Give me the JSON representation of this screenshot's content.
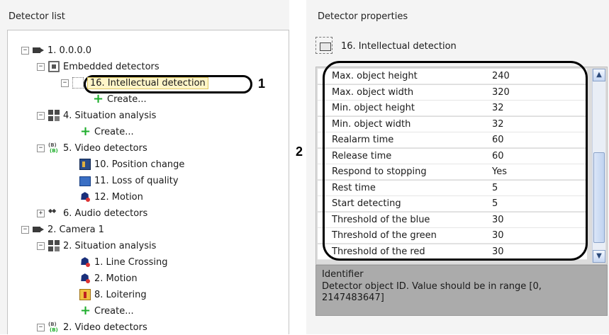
{
  "left_panel": {
    "title": "Detector list",
    "tree": [
      {
        "label": "1. 0.0.0.0",
        "icon": "camera-icon",
        "expander": "−"
      },
      {
        "label": "Embedded detectors",
        "icon": "embedded-detector-icon",
        "expander": "−"
      },
      {
        "label": "16. Intellectual detection",
        "icon": "intellectual-detection-icon",
        "expander": "−",
        "selected": true
      },
      {
        "label": "Create...",
        "icon": "green-plus-icon"
      },
      {
        "label": "4. Situation analysis",
        "icon": "situation-analysis-icon",
        "expander": "−"
      },
      {
        "label": "Create...",
        "icon": "green-plus-icon"
      },
      {
        "label": "5. Video detectors",
        "icon": "video-detectors-icon",
        "expander": "−"
      },
      {
        "label": "10. Position change",
        "icon": "position-change-icon"
      },
      {
        "label": "11. Loss of quality",
        "icon": "loss-of-quality-icon"
      },
      {
        "label": "12. Motion",
        "icon": "motion-icon"
      },
      {
        "label": "6. Audio detectors",
        "icon": "audio-detectors-icon",
        "expander": "+"
      },
      {
        "label": "2. Camera 1",
        "icon": "camera-icon",
        "expander": "−"
      },
      {
        "label": "2. Situation analysis",
        "icon": "situation-analysis-icon",
        "expander": "−"
      },
      {
        "label": "1. Line Crossing",
        "icon": "line-crossing-icon"
      },
      {
        "label": "2. Motion",
        "icon": "motion-icon"
      },
      {
        "label": "8. Loitering",
        "icon": "loitering-icon"
      },
      {
        "label": "Create...",
        "icon": "green-plus-icon"
      },
      {
        "label": "2. Video detectors",
        "icon": "video-detectors-icon",
        "expander": "−"
      }
    ]
  },
  "callouts": {
    "first": "1",
    "second": "2"
  },
  "right_panel": {
    "title": "Detector properties",
    "detector_name": "16. Intellectual detection",
    "properties": [
      {
        "key": "Max. object height",
        "value": "240"
      },
      {
        "key": "Max. object width",
        "value": "320"
      },
      {
        "key": "Min. object height",
        "value": "32"
      },
      {
        "key": "Min. object width",
        "value": "32"
      },
      {
        "key": "Realarm time",
        "value": "60"
      },
      {
        "key": "Release time",
        "value": "60"
      },
      {
        "key": "Respond to stopping",
        "value": "Yes"
      },
      {
        "key": "Rest time",
        "value": "5"
      },
      {
        "key": "Start detecting",
        "value": "5"
      },
      {
        "key": "Threshold of the blue",
        "value": "30"
      },
      {
        "key": "Threshold of the green",
        "value": "30"
      },
      {
        "key": "Threshold of the red",
        "value": "30"
      }
    ],
    "scroll": {
      "up": "▲",
      "down": "▼"
    },
    "description": {
      "title": "Identifier",
      "text": "Detector object ID. Value should be in range [0, 2147483647]"
    }
  }
}
